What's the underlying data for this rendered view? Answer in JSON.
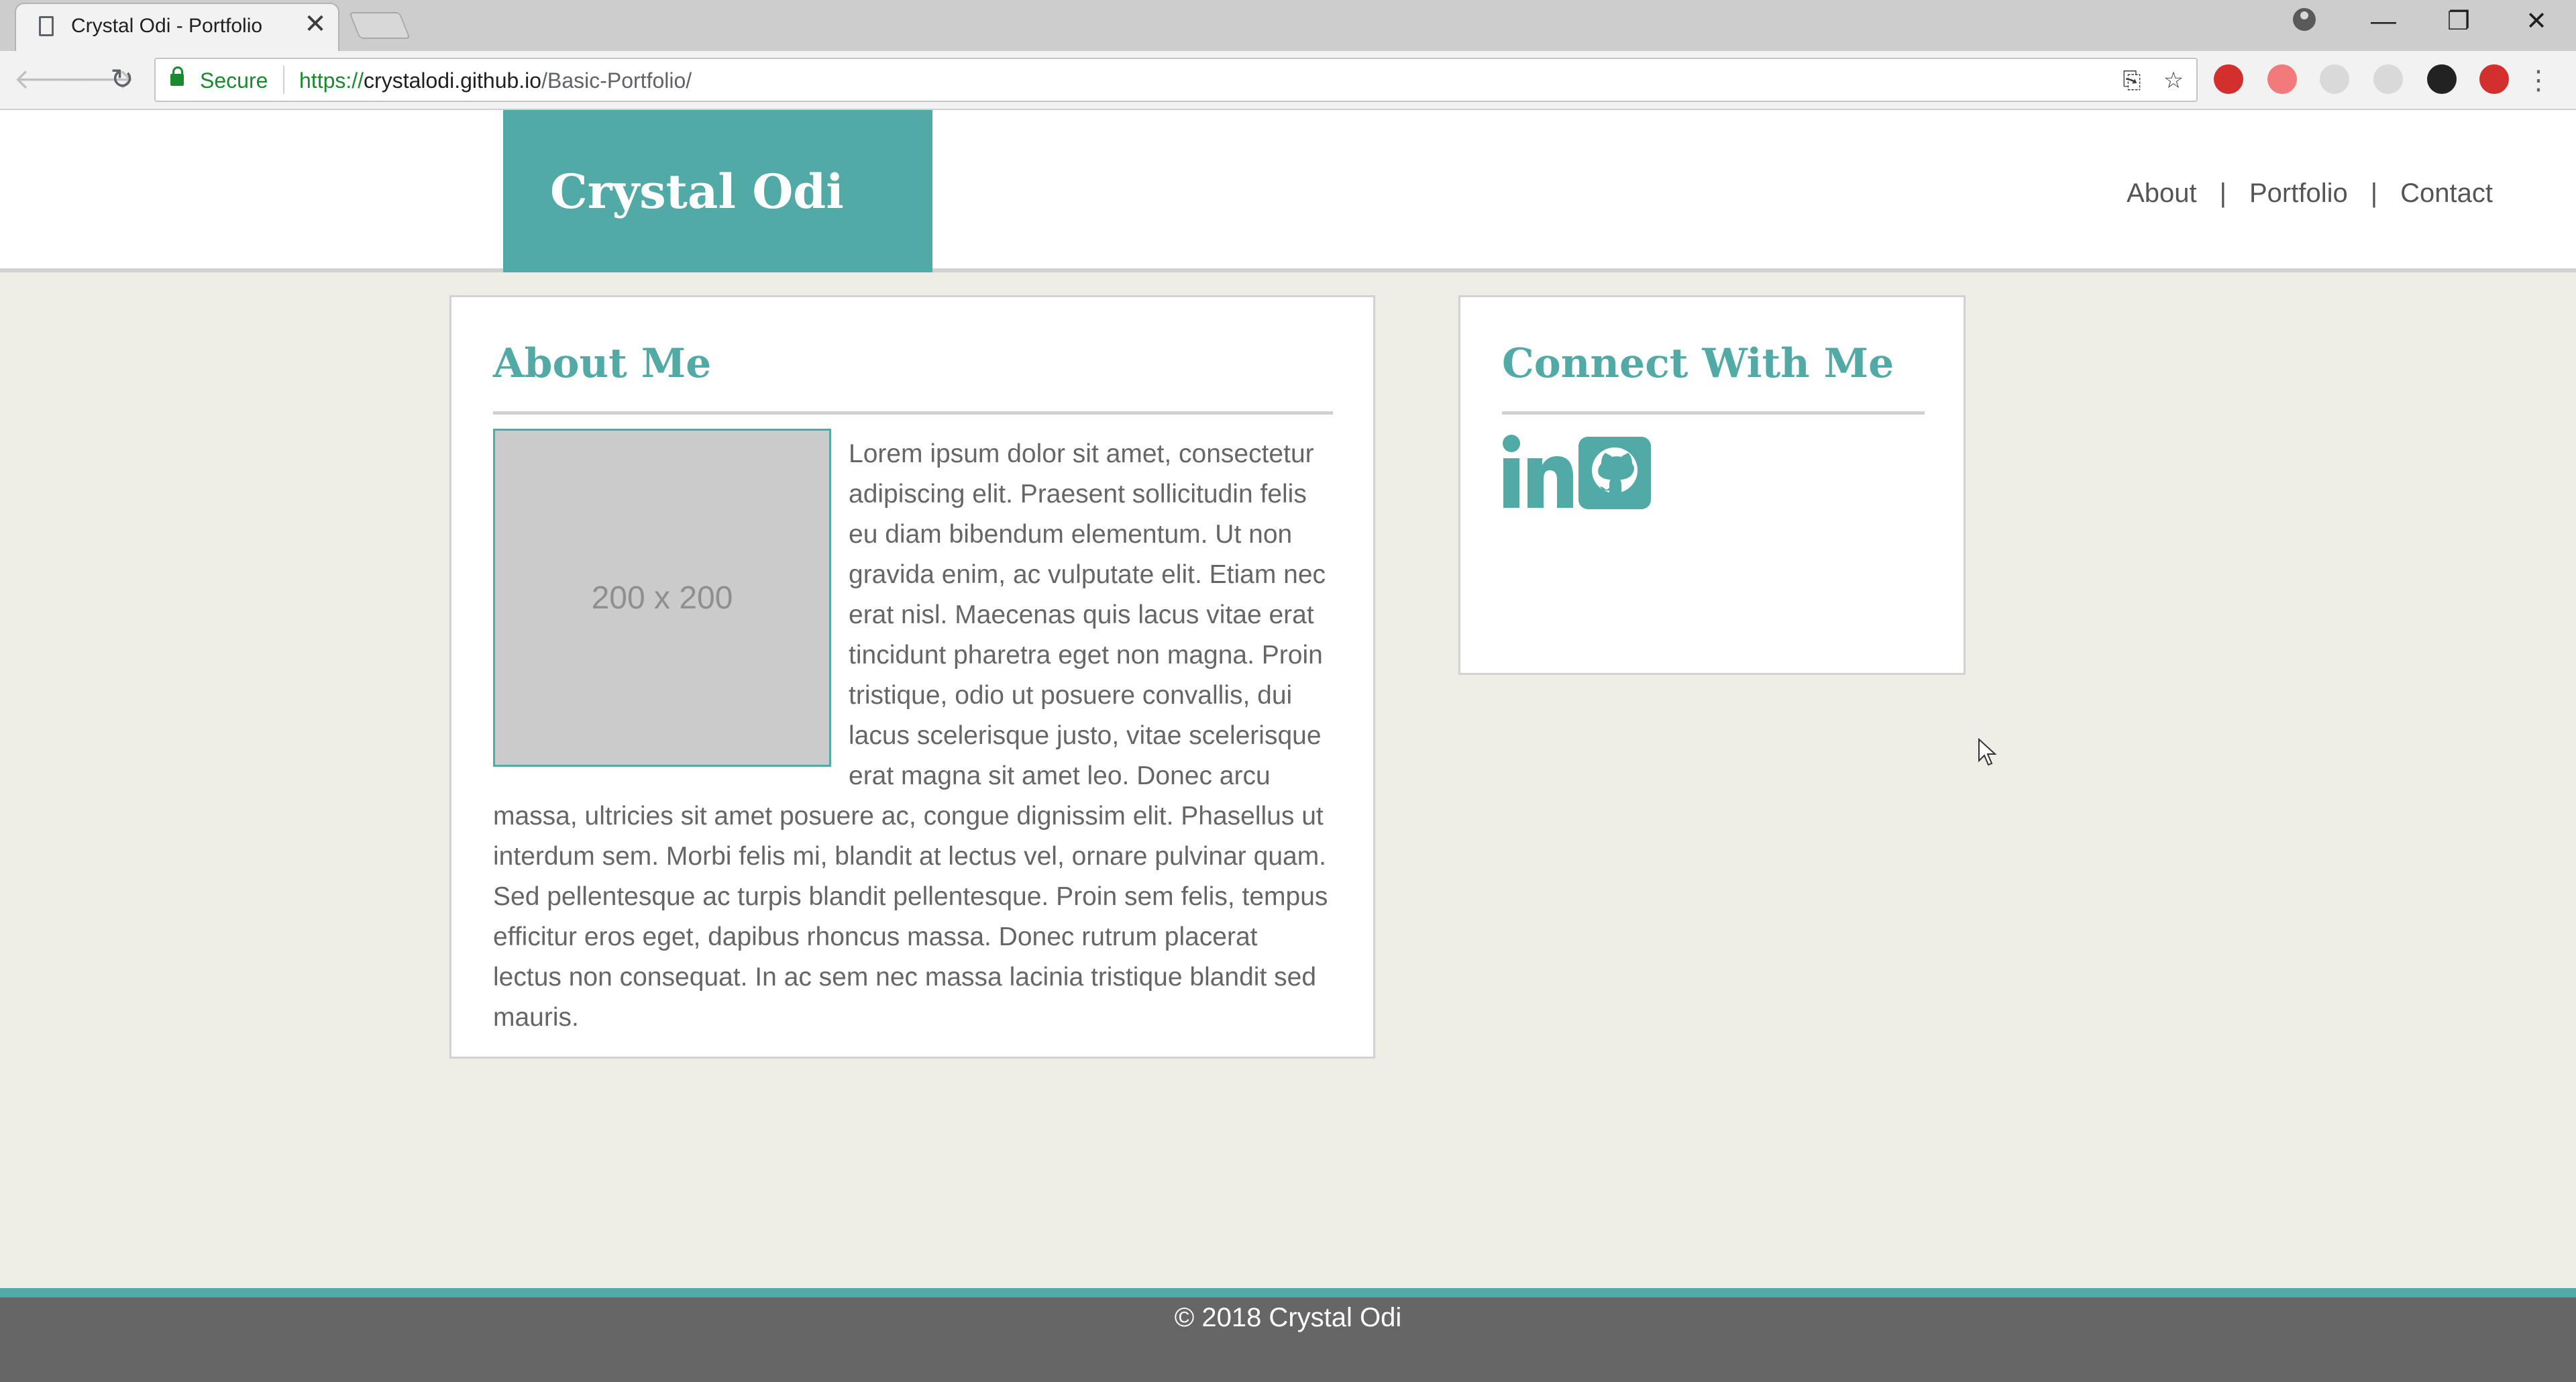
{
  "browser": {
    "tab_title": "Crystal Odi - Portfolio",
    "tab_close": "✕",
    "back_icon": "🡐",
    "forward_icon": "🡒",
    "reload_icon": "↻",
    "secure_label": "Secure",
    "url_scheme": "https://",
    "url_host": "crystalodi.github.io",
    "url_path": "/Basic-Portfolio/",
    "translate_icon": "⎘",
    "bookmark_icon": "☆",
    "menu_icon": "⋮",
    "minimize": "—",
    "restore": "❐",
    "close": "✕",
    "extension_colors": [
      "#d32f2f",
      "#f27a7a",
      "#d9d9d9",
      "#d9d9d9",
      "#222222",
      "#d32f2f"
    ]
  },
  "header": {
    "logo": "Crystal Odi",
    "nav": {
      "about": "About",
      "portfolio": "Portfolio",
      "contact": "Contact",
      "separator": "|"
    }
  },
  "about": {
    "title": "About Me",
    "image_placeholder": "200 x 200",
    "body": "Lorem ipsum dolor sit amet, consectetur adipiscing elit. Praesent sollicitudin felis eu diam bibendum elementum. Ut non gravida enim, ac vulputate elit. Etiam nec erat nisl. Maecenas quis lacus vitae erat tincidunt pharetra eget non magna. Proin tristique, odio ut posuere convallis, dui lacus scelerisque justo, vitae scelerisque erat magna sit amet leo. Donec arcu massa, ultricies sit amet posuere ac, congue dignissim elit. Phasellus ut interdum sem. Morbi felis mi, blandit at lectus vel, ornare pulvinar quam. Sed pellentesque ac turpis blandit pellentesque. Proin sem felis, tempus efficitur eros eget, dapibus rhoncus massa. Donec rutrum placerat lectus non consequat. In ac sem nec massa lacinia tristique blandit sed mauris."
  },
  "connect": {
    "title": "Connect With Me",
    "icons": [
      "linkedin-icon",
      "github-icon"
    ]
  },
  "footer": {
    "text": "© 2018 Crystal Odi"
  },
  "colors": {
    "accent": "#52aaa6",
    "page_bg": "#eeede6",
    "footer_bg": "#666666"
  }
}
